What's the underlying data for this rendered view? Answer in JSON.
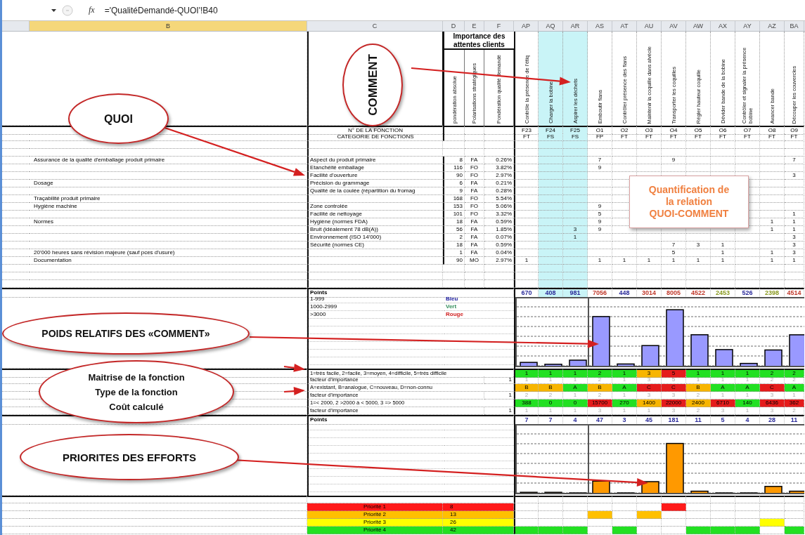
{
  "formula_bar": {
    "function_label": "fx",
    "formula": "='QualitéDemandé-QUOI'!B40"
  },
  "column_headers": [
    {
      "label": "B",
      "selected": true
    },
    {
      "label": "C",
      "selected": false
    },
    {
      "label": "D",
      "selected": false
    },
    {
      "label": "E",
      "selected": false
    },
    {
      "label": "F",
      "selected": false
    },
    {
      "label": "AP",
      "selected": false
    },
    {
      "label": "AQ",
      "selected": false
    },
    {
      "label": "AR",
      "selected": false
    },
    {
      "label": "AS",
      "selected": false
    },
    {
      "label": "AT",
      "selected": false
    },
    {
      "label": "AU",
      "selected": false
    },
    {
      "label": "AV",
      "selected": false
    },
    {
      "label": "AW",
      "selected": false
    },
    {
      "label": "AX",
      "selected": false
    },
    {
      "label": "AY",
      "selected": false
    },
    {
      "label": "AZ",
      "selected": false
    },
    {
      "label": "BA",
      "selected": false
    }
  ],
  "importance_title": "Importance des attentes clients",
  "weight_headers": [
    "pondération absolue",
    "Polarisations stratégiques",
    "Pondération qualité demandé"
  ],
  "function_number_label": "N° DE LA FONCTION",
  "category_label": "CATEGORIE DE FONCTIONS",
  "functions": [
    {
      "name": "Contrôle la présence de l'étiq",
      "number": "F23",
      "category": "FT",
      "highlighted": false
    },
    {
      "name": "Charger la bobine",
      "number": "F24",
      "category": "FS",
      "highlighted": true
    },
    {
      "name": "Aspirer les déchets",
      "number": "F25",
      "category": "FS",
      "highlighted": true
    },
    {
      "name": "Emboutir flans",
      "number": "O1",
      "category": "FP",
      "highlighted": false
    },
    {
      "name": "Contrôler présence des flans",
      "number": "O2",
      "category": "FT",
      "highlighted": false
    },
    {
      "name": "Maintenir la coquille dans alvéole",
      "number": "O3",
      "category": "FT",
      "highlighted": false
    },
    {
      "name": "Transporter les coquilles",
      "number": "O4",
      "category": "FT",
      "highlighted": false
    },
    {
      "name": "Régler hauteur coquille",
      "number": "O5",
      "category": "FT",
      "highlighted": false
    },
    {
      "name": "Dévider bande de la bobine",
      "number": "O6",
      "category": "FT",
      "highlighted": false
    },
    {
      "name": "Contrôler et signaler la présence bobine",
      "number": "O7",
      "category": "FT",
      "highlighted": false
    },
    {
      "name": "Avancer bande",
      "number": "O8",
      "category": "FT",
      "highlighted": false
    },
    {
      "name": "Découper les couvercles",
      "number": "O9",
      "category": "FT",
      "highlighted": false
    }
  ],
  "requirements": [
    {
      "quoi": "Assurance  de la qualité d'emballage produit primaire",
      "detail": "Aspect du produit primaire",
      "weight": "8",
      "polarisation": "FA",
      "share": "0.26%",
      "relations": [
        {
          "kind": "blank"
        },
        {
          "kind": "blank"
        },
        {
          "kind": "blank"
        },
        {
          "kind": "score",
          "value": "7"
        },
        {
          "kind": "blank"
        },
        {
          "kind": "blank"
        },
        {
          "kind": "score",
          "value": "9"
        },
        {
          "kind": "blank"
        },
        {
          "kind": "blank"
        },
        {
          "kind": "blank"
        },
        {
          "kind": "blank"
        },
        {
          "kind": "score",
          "value": "7"
        }
      ]
    },
    {
      "detail": "Etanchéité emballage",
      "weight": "116",
      "polarisation": "FO",
      "share": "3.82%",
      "relations": [
        {
          "kind": "blank"
        },
        {
          "kind": "blank"
        },
        {
          "kind": "blank"
        },
        {
          "kind": "score",
          "value": "9"
        },
        {
          "kind": "blank"
        },
        {
          "kind": "blank"
        },
        {
          "kind": "blank"
        },
        {
          "kind": "blank"
        },
        {
          "kind": "blank"
        },
        {
          "kind": "blank"
        },
        {
          "kind": "blank"
        },
        {
          "kind": "blank"
        }
      ]
    },
    {
      "detail": "Facilité d'ouverture",
      "weight": "90",
      "polarisation": "FO",
      "share": "2.97%",
      "relations": [
        {
          "kind": "blank"
        },
        {
          "kind": "blank"
        },
        {
          "kind": "blank"
        },
        {
          "kind": "blank"
        },
        {
          "kind": "blank"
        },
        {
          "kind": "blank"
        },
        {
          "kind": "blank"
        },
        {
          "kind": "blank"
        },
        {
          "kind": "blank"
        },
        {
          "kind": "blank"
        },
        {
          "kind": "blank"
        },
        {
          "kind": "score",
          "value": "3"
        }
      ]
    },
    {
      "quoi": "Dosage",
      "detail": "Précision du grammage",
      "weight": "6",
      "polarisation": "FA",
      "share": "0.21%"
    },
    {
      "detail": "Qualité de la coulée (répartition du fromag",
      "weight": "9",
      "polarisation": "FA",
      "share": "0.28%"
    },
    {
      "quoi": "Traçabilité produit primaire",
      "weight": "168",
      "polarisation": "FO",
      "share": "5.54%"
    },
    {
      "quoi": "Hygiène machine",
      "detail": "Zone controlée",
      "weight": "153",
      "polarisation": "FO",
      "share": "5.06%",
      "relations": [
        {
          "kind": "blank"
        },
        {
          "kind": "blank"
        },
        {
          "kind": "blank"
        },
        {
          "kind": "score",
          "value": "9"
        },
        {
          "kind": "blank"
        },
        {
          "kind": "blank"
        },
        {
          "kind": "blank"
        },
        {
          "kind": "blank"
        },
        {
          "kind": "blank"
        },
        {
          "kind": "blank"
        },
        {
          "kind": "blank"
        },
        {
          "kind": "blank"
        }
      ]
    },
    {
      "detail": "Facilité de nettoyage",
      "weight": "101",
      "polarisation": "FO",
      "share": "3.32%",
      "relations": [
        {
          "kind": "blank"
        },
        {
          "kind": "blank"
        },
        {
          "kind": "blank"
        },
        {
          "kind": "score",
          "value": "5"
        },
        {
          "kind": "blank"
        },
        {
          "kind": "blank"
        },
        {
          "kind": "blank"
        },
        {
          "kind": "blank"
        },
        {
          "kind": "blank"
        },
        {
          "kind": "blank"
        },
        {
          "kind": "blank"
        },
        {
          "kind": "score",
          "value": "1"
        }
      ]
    },
    {
      "quoi": "Normes",
      "detail": "Hygiène (normes FDA)",
      "weight": "18",
      "polarisation": "FA",
      "share": "0.59%",
      "relations": [
        {
          "kind": "blank"
        },
        {
          "kind": "blank"
        },
        {
          "kind": "blank"
        },
        {
          "kind": "score",
          "value": "9"
        },
        {
          "kind": "blank"
        },
        {
          "kind": "blank"
        },
        {
          "kind": "blank"
        },
        {
          "kind": "blank"
        },
        {
          "kind": "blank"
        },
        {
          "kind": "blank"
        },
        {
          "kind": "score",
          "value": "1"
        },
        {
          "kind": "score",
          "value": "1"
        }
      ]
    },
    {
      "detail": "Bruit (idéalement 78 dB(A))",
      "weight": "56",
      "polarisation": "FA",
      "share": "1.85%",
      "relations": [
        {
          "kind": "blank"
        },
        {
          "kind": "blank"
        },
        {
          "kind": "score",
          "value": "3"
        },
        {
          "kind": "score",
          "value": "9"
        },
        {
          "kind": "blank"
        },
        {
          "kind": "blank"
        },
        {
          "kind": "blank"
        },
        {
          "kind": "blank"
        },
        {
          "kind": "blank"
        },
        {
          "kind": "blank"
        },
        {
          "kind": "score",
          "value": "1"
        },
        {
          "kind": "score",
          "value": "1"
        }
      ]
    },
    {
      "detail": "Environnement (ISO 14'000)",
      "weight": "2",
      "polarisation": "FA",
      "share": "0.07%",
      "relations": [
        {
          "kind": "blank"
        },
        {
          "kind": "blank"
        },
        {
          "kind": "score",
          "value": "1"
        },
        {
          "kind": "blank"
        },
        {
          "kind": "blank"
        },
        {
          "kind": "blank"
        },
        {
          "kind": "blank"
        },
        {
          "kind": "blank"
        },
        {
          "kind": "blank"
        },
        {
          "kind": "blank"
        },
        {
          "kind": "blank"
        },
        {
          "kind": "score",
          "value": "3"
        }
      ]
    },
    {
      "detail": "Sécurité (normes CE)",
      "weight": "18",
      "polarisation": "FA",
      "share": "0.59%",
      "relations": [
        {
          "kind": "blank"
        },
        {
          "kind": "blank"
        },
        {
          "kind": "blank"
        },
        {
          "kind": "blank"
        },
        {
          "kind": "blank"
        },
        {
          "kind": "blank"
        },
        {
          "kind": "score",
          "value": "7"
        },
        {
          "kind": "score",
          "value": "3"
        },
        {
          "kind": "score",
          "value": "1"
        },
        {
          "kind": "blank"
        },
        {
          "kind": "blank"
        },
        {
          "kind": "score",
          "value": "3"
        }
      ]
    },
    {
      "quoi": "20'000 heures sans révision majeure (sauf pces d'usure)",
      "weight": "1",
      "polarisation": "FA",
      "share": "0.04%",
      "relations": [
        {
          "kind": "blank"
        },
        {
          "kind": "blank"
        },
        {
          "kind": "blank"
        },
        {
          "kind": "blank"
        },
        {
          "kind": "blank"
        },
        {
          "kind": "blank"
        },
        {
          "kind": "score",
          "value": "5"
        },
        {
          "kind": "blank"
        },
        {
          "kind": "score",
          "value": "1"
        },
        {
          "kind": "blank"
        },
        {
          "kind": "score",
          "value": "1"
        },
        {
          "kind": "score",
          "value": "3"
        }
      ]
    },
    {
      "quoi": "Documentation",
      "weight": "90",
      "polarisation": "MO",
      "share": "2.97%",
      "relations": [
        {
          "kind": "score",
          "value": "1"
        },
        {
          "kind": "blank"
        },
        {
          "kind": "blank"
        },
        {
          "kind": "score",
          "value": "1"
        },
        {
          "kind": "score",
          "value": "1"
        },
        {
          "kind": "score",
          "value": "1"
        },
        {
          "kind": "score",
          "value": "1"
        },
        {
          "kind": "score",
          "value": "1"
        },
        {
          "kind": "score",
          "value": "1"
        },
        {
          "kind": "blank"
        },
        {
          "kind": "score",
          "value": "1"
        },
        {
          "kind": "score",
          "value": "1"
        }
      ]
    }
  ],
  "weights": {
    "label": "Points",
    "values": [
      {
        "value": "670",
        "color": "#2b2b9a"
      },
      {
        "value": "408",
        "color": "#2b2b9a"
      },
      {
        "value": "981",
        "color": "#2b2b9a"
      },
      {
        "value": "7056",
        "color": "#c0392b"
      },
      {
        "value": "448",
        "color": "#2b2b9a"
      },
      {
        "value": "3014",
        "color": "#c0392b"
      },
      {
        "value": "8005",
        "color": "#c0392b"
      },
      {
        "value": "4522",
        "color": "#c0392b"
      },
      {
        "value": "2453",
        "color": "#8a9a22"
      },
      {
        "value": "526",
        "color": "#2b2b9a"
      },
      {
        "value": "2398",
        "color": "#8a9a22"
      },
      {
        "value": "4514",
        "color": "#c0392b"
      }
    ],
    "legend": [
      {
        "range": "1-999",
        "name": "Bleu",
        "color": "#1a1a9c"
      },
      {
        "range": "1000-2999",
        "name": "Vert",
        "color": "#2e8b57"
      },
      {
        "range": ">3000",
        "name": "Rouge",
        "color": "#d02020"
      }
    ]
  },
  "ratings": [
    {
      "kind": "criterion",
      "label": "1=très facile, 2=facile, 3=moyen, 4=difficile, 5=très difficile",
      "cells": [
        {
          "value": "1",
          "color": "#22e022"
        },
        {
          "value": "1",
          "color": "#22e022"
        },
        {
          "value": "1",
          "color": "#22e022"
        },
        {
          "value": "2",
          "color": "#22e022"
        },
        {
          "value": "1",
          "color": "#22e022"
        },
        {
          "value": "3",
          "color": "#f7b500"
        },
        {
          "value": "5",
          "color": "#e51c1c"
        },
        {
          "value": "1",
          "color": "#22e022"
        },
        {
          "value": "1",
          "color": "#22e022"
        },
        {
          "value": "1",
          "color": "#22e022"
        },
        {
          "value": "2",
          "color": "#22e022"
        },
        {
          "value": "2",
          "color": "#22e022"
        }
      ]
    },
    {
      "kind": "factor",
      "label": "facteur d'importance",
      "factor": "1",
      "values": [
        "1",
        "1",
        "1",
        "2",
        "1",
        "3",
        "5",
        "1",
        "1",
        "1",
        "2",
        "2"
      ]
    },
    {
      "kind": "criterion",
      "label": "A=existant, B=analogue, C=nouveau, D=non-connu",
      "cells": [
        {
          "value": "B",
          "color": "#f7b500"
        },
        {
          "value": "B",
          "color": "#f7b500"
        },
        {
          "value": "A",
          "color": "#22e022"
        },
        {
          "value": "B",
          "color": "#f7b500"
        },
        {
          "value": "A",
          "color": "#22e022"
        },
        {
          "value": "C",
          "color": "#e51c1c"
        },
        {
          "value": "C",
          "color": "#e51c1c"
        },
        {
          "value": "B",
          "color": "#f7b500"
        },
        {
          "value": "A",
          "color": "#22e022"
        },
        {
          "value": "A",
          "color": "#22e022"
        },
        {
          "value": "C",
          "color": "#e51c1c"
        },
        {
          "value": "A",
          "color": "#22e022"
        }
      ]
    },
    {
      "kind": "factor",
      "label": "facteur d'importance",
      "factor": "1",
      "values": [
        "2",
        "2",
        "1",
        "2",
        "1",
        "3",
        "3",
        "2",
        "1",
        "1",
        "3",
        "1"
      ]
    },
    {
      "kind": "criterion",
      "label": "1=< 2000, 2 >2000 à < 5000, 3 => 5000",
      "cells": [
        {
          "value": "388",
          "color": "#22e022"
        },
        {
          "value": "0",
          "color": "#22e022"
        },
        {
          "value": "0",
          "color": "#22e022"
        },
        {
          "value": "15700",
          "color": "#e51c1c"
        },
        {
          "value": "270",
          "color": "#22e022"
        },
        {
          "value": "1400",
          "color": "#f7b500"
        },
        {
          "value": "22000",
          "color": "#e51c1c"
        },
        {
          "value": "2400",
          "color": "#f7b500"
        },
        {
          "value": "6710",
          "color": "#e51c1c"
        },
        {
          "value": "140",
          "color": "#22e022"
        },
        {
          "value": "6436",
          "color": "#e51c1c"
        },
        {
          "value": "362",
          "color": "#e51c1c"
        }
      ]
    },
    {
      "kind": "factor",
      "label": "facteur d'importance",
      "factor": "1",
      "values": [
        "1",
        "1",
        "1",
        "3",
        "1",
        "1",
        "3",
        "2",
        "3",
        "1",
        "3",
        "2"
      ]
    }
  ],
  "efforts": {
    "label": "Points",
    "values": [
      {
        "value": "7",
        "color": "#2b2b9a"
      },
      {
        "value": "7",
        "color": "#2b2b9a"
      },
      {
        "value": "4",
        "color": "#2b2b9a"
      },
      {
        "value": "47",
        "color": "#2b2b9a"
      },
      {
        "value": "3",
        "color": "#2b2b9a"
      },
      {
        "value": "45",
        "color": "#2b2b9a"
      },
      {
        "value": "181",
        "color": "#2b2b9a"
      },
      {
        "value": "11",
        "color": "#2b2b9a"
      },
      {
        "value": "5",
        "color": "#2b2b9a"
      },
      {
        "value": "4",
        "color": "#2b2b9a"
      },
      {
        "value": "28",
        "color": "#2b2b9a"
      },
      {
        "value": "11",
        "color": "#2b2b9a"
      }
    ]
  },
  "priorities": [
    {
      "label": "Priorité 1",
      "count": "8",
      "color": "#ff1a1a",
      "marks": [
        false,
        false,
        false,
        false,
        false,
        false,
        true,
        false,
        false,
        false,
        false,
        false
      ]
    },
    {
      "label": "Priorité 2",
      "count": "13",
      "color": "#ffc000",
      "marks": [
        false,
        false,
        false,
        true,
        false,
        true,
        false,
        false,
        false,
        false,
        false,
        false
      ]
    },
    {
      "label": "Priorité 3",
      "count": "26",
      "color": "#ffff00",
      "marks": [
        false,
        false,
        false,
        false,
        false,
        false,
        false,
        false,
        false,
        false,
        true,
        false
      ]
    },
    {
      "label": "Priorité 4",
      "count": "42",
      "color": "#22e022",
      "marks": [
        true,
        true,
        true,
        false,
        true,
        false,
        false,
        true,
        true,
        true,
        false,
        true
      ]
    }
  ],
  "annotations": [
    {
      "lines": [
        "QUOI"
      ]
    },
    {
      "lines": [
        "COMMENT"
      ]
    },
    {
      "lines": [
        "POIDS RELATIFS DES «COMMENT»"
      ]
    },
    {
      "lines": [
        "Maitrise de la fonction",
        "Type de la fonction",
        "Coût calculé"
      ]
    },
    {
      "lines": [
        "PRIORITES DES EFFORTS"
      ]
    }
  ],
  "callout": {
    "lines": [
      "Quantification de",
      "la relation",
      "QUOI-COMMENT"
    ]
  }
}
